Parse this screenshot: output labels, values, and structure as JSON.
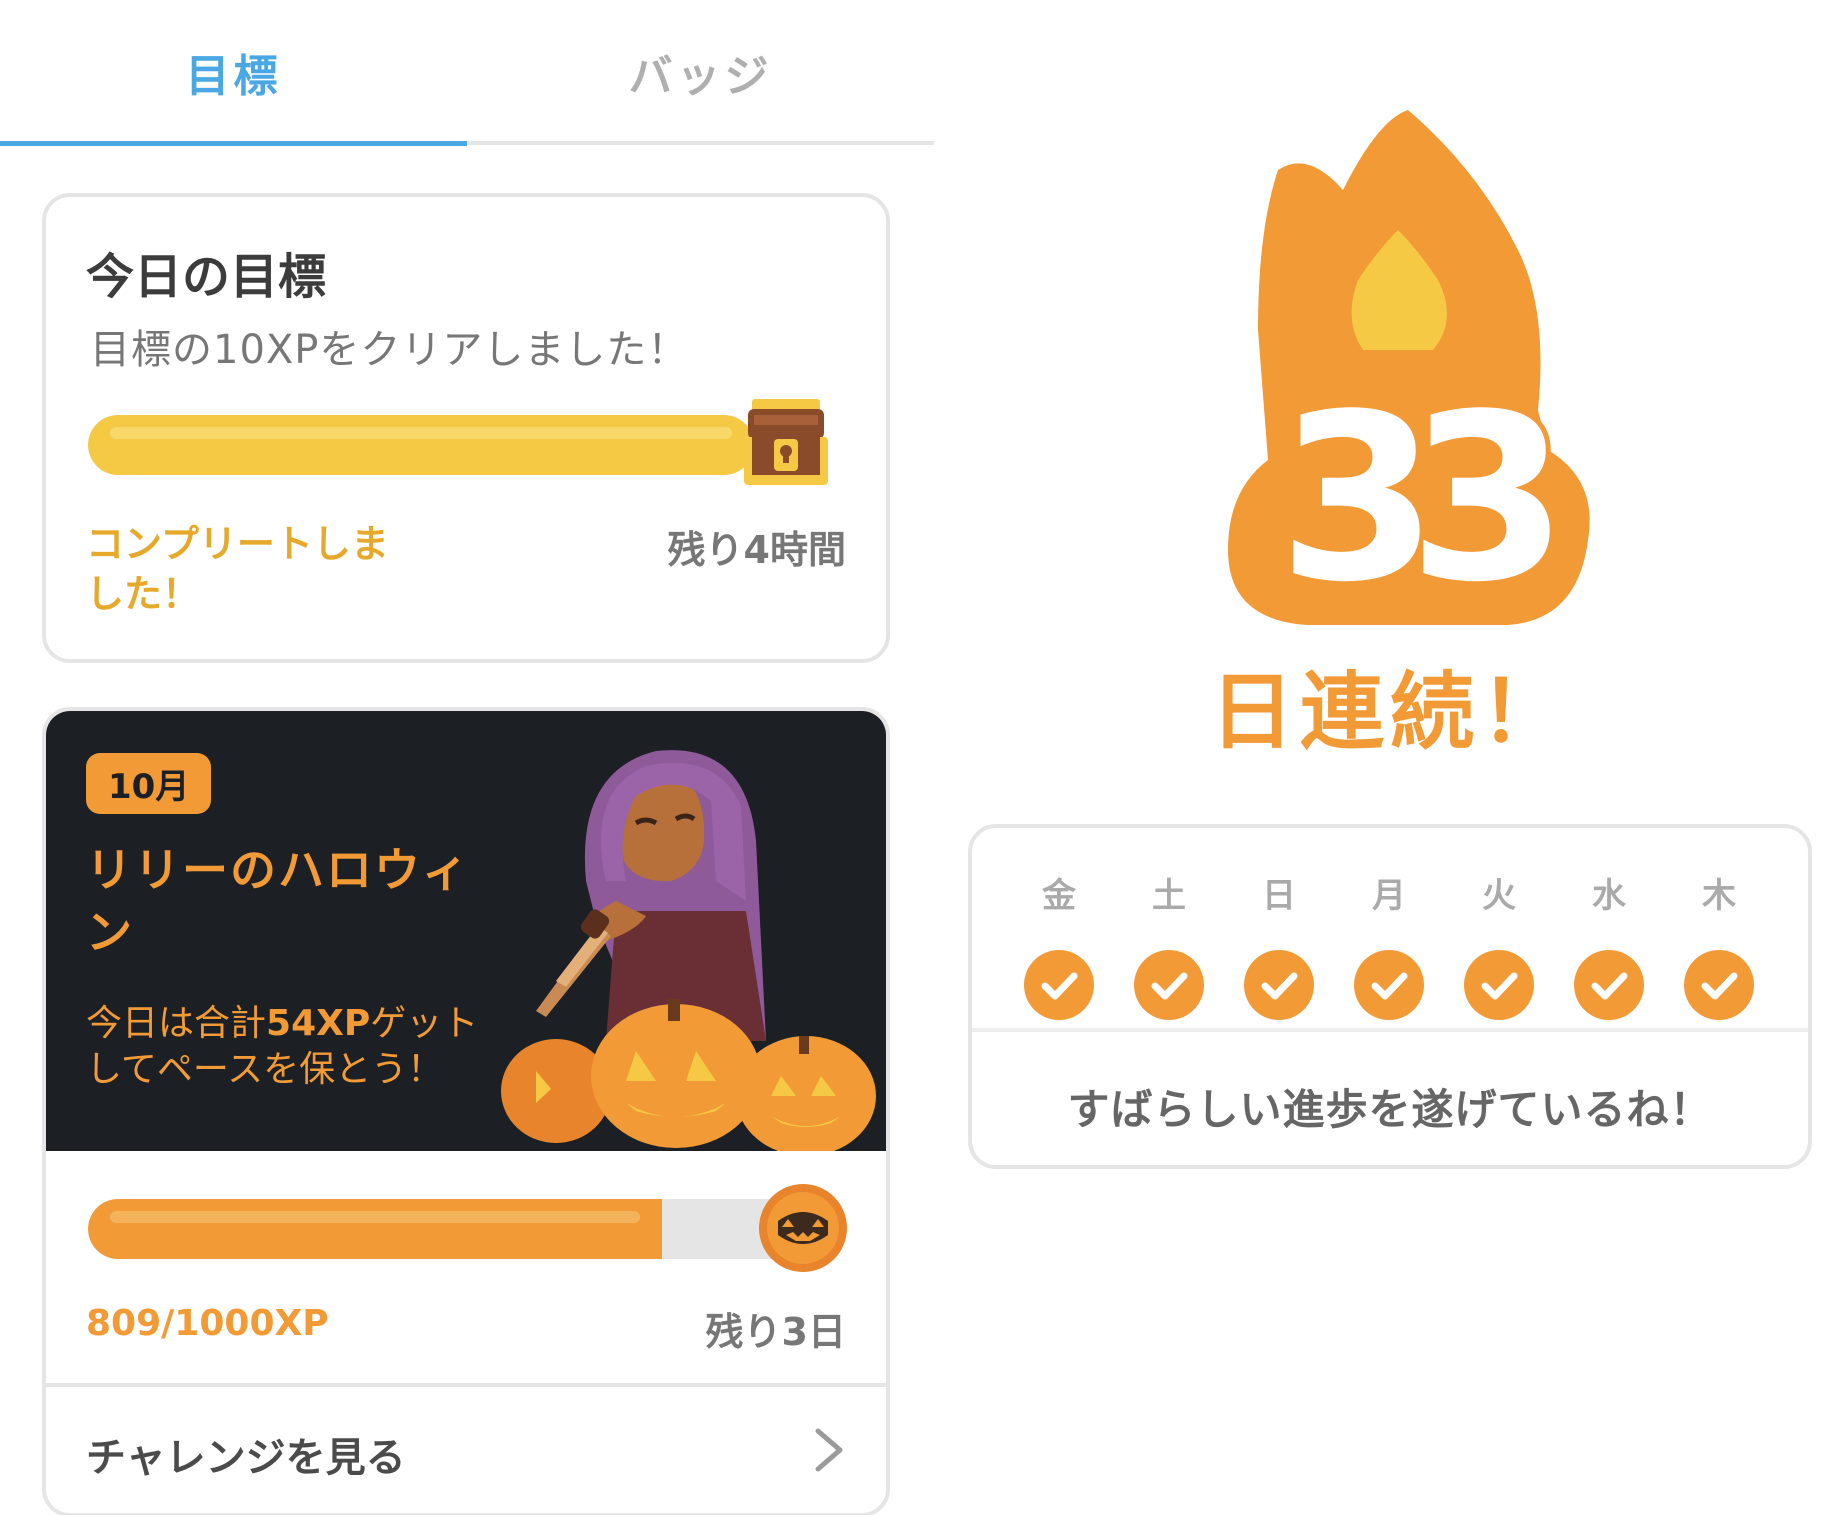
{
  "tabs": [
    {
      "label": "目標",
      "active": true
    },
    {
      "label": "バッジ",
      "active": false
    }
  ],
  "daily_goal": {
    "title": "今日の目標",
    "subtitle": "目標の10XPをクリアしました！",
    "progress": 1.0,
    "status": "コンプリートしました！",
    "remaining": "残り4時間",
    "reward_icon": "treasure-chest-icon",
    "bar_color": "#f6c944"
  },
  "challenge": {
    "month_badge": "10月",
    "title": "リリーのハロウィン",
    "desc_prefix": "今日は合計",
    "desc_highlight": "54XP",
    "desc_suffix": "ゲットしてペースを保とう！",
    "progress": 0.809,
    "progress_text": "809/1000XP",
    "remaining": "残り3日",
    "link_label": "チャレンジを見る",
    "coin_icon": "jack-o-lantern-coin-icon",
    "accent_color": "#f19a36"
  },
  "streak": {
    "count": "33",
    "label": "日連続！",
    "flame_color": "#f19a36",
    "days": [
      {
        "label": "金",
        "done": true
      },
      {
        "label": "土",
        "done": true
      },
      {
        "label": "日",
        "done": true
      },
      {
        "label": "月",
        "done": true
      },
      {
        "label": "火",
        "done": true
      },
      {
        "label": "水",
        "done": true
      },
      {
        "label": "木",
        "done": true
      }
    ],
    "message": "すばらしい進歩を遂げているね！"
  }
}
